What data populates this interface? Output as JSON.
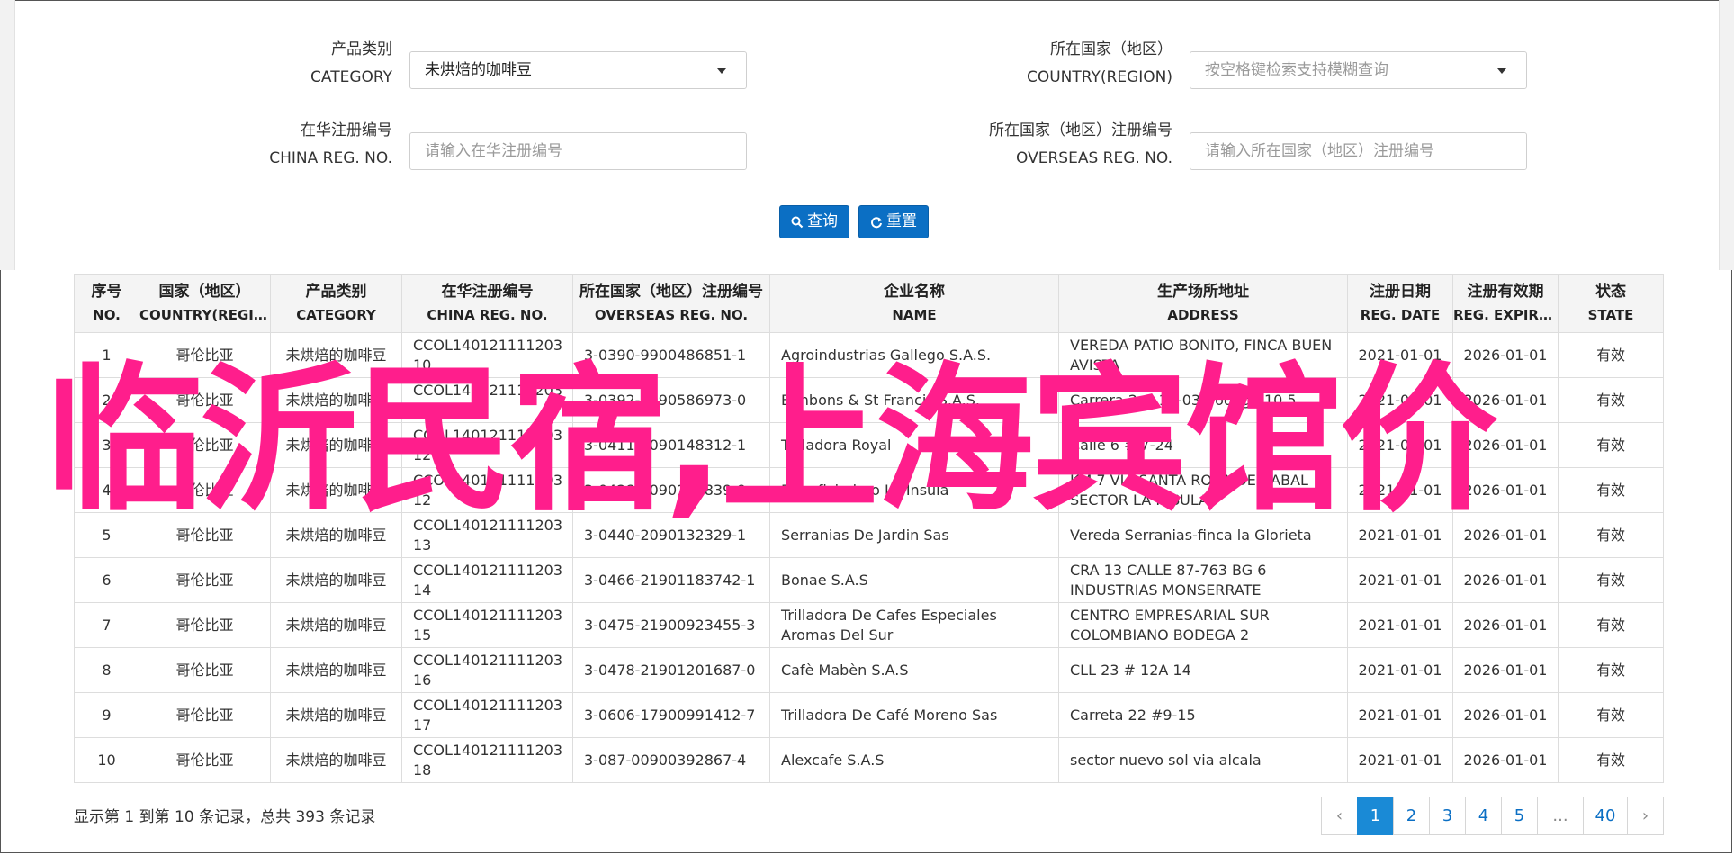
{
  "form": {
    "category": {
      "label_cn": "产品类别",
      "label_en": "CATEGORY",
      "value": "未烘焙的咖啡豆"
    },
    "country": {
      "label_cn": "所在国家（地区）",
      "label_en": "COUNTRY(REGION)",
      "placeholder": "按空格键检索支持模糊查询"
    },
    "china_reg": {
      "label_cn": "在华注册编号",
      "label_en": "CHINA REG. NO.",
      "placeholder": "请输入在华注册编号"
    },
    "overseas_reg": {
      "label_cn": "所在国家（地区）注册编号",
      "label_en": "OVERSEAS REG. NO.",
      "placeholder": "请输入所在国家（地区）注册编号"
    },
    "search_button": "查询",
    "reset_button": "重置"
  },
  "table": {
    "headers": [
      {
        "cn": "序号",
        "en": "NO."
      },
      {
        "cn": "国家（地区）",
        "en": "COUNTRY(REGIO..."
      },
      {
        "cn": "产品类别",
        "en": "CATEGORY"
      },
      {
        "cn": "在华注册编号",
        "en": "CHINA REG. NO."
      },
      {
        "cn": "所在国家（地区）注册编号",
        "en": "OVERSEAS REG. NO."
      },
      {
        "cn": "企业名称",
        "en": "NAME"
      },
      {
        "cn": "生产场所地址",
        "en": "ADDRESS"
      },
      {
        "cn": "注册日期",
        "en": "REG. DATE"
      },
      {
        "cn": "注册有效期",
        "en": "REG. EXPIRE ..."
      },
      {
        "cn": "状态",
        "en": "STATE"
      }
    ],
    "rows": [
      [
        "1",
        "哥伦比亚",
        "未烘焙的咖啡豆",
        "CCOL140121111203 10",
        "3-0390-9900486851-1",
        "Agroindustrias Gallego S.A.S.",
        "VEREDA PATIO BONITO, FINCA BUEN AVISTA",
        "2021-01-01",
        "2026-01-01",
        "有效"
      ],
      [
        "2",
        "哥伦比亚",
        "未烘焙的咖啡豆",
        "CCOL140121111203 11",
        "3-0392-1990586973-0",
        "Bonbons & St Francis S.A.S.",
        "Carrera 2 # 13-03 Bodega 10 5",
        "2021-01-01",
        "2026-01-01",
        "有效"
      ],
      [
        "3",
        "哥伦比亚",
        "未烘焙的咖啡豆",
        "CCOL140121111203 12",
        "3-0411-2090148312-1",
        "Trilladora Royal",
        "Calle 6 # 7-24",
        "2021-01-01",
        "2026-01-01",
        "有效"
      ],
      [
        "4",
        "哥伦比亚",
        "未烘焙的咖啡豆",
        "CCOL140121111203 12",
        "3-0428-2090128839-9",
        "Beneficiadero La Insula",
        "KM 7 VIA SANTA ROSA DE CABAL SECTOR LA INSULA",
        "2021-01-01",
        "2026-01-01",
        "有效"
      ],
      [
        "5",
        "哥伦比亚",
        "未烘焙的咖啡豆",
        "CCOL140121111203 13",
        "3-0440-2090132329-1",
        "Serranias De Jardin Sas",
        "Vereda Serranias-finca la Glorieta",
        "2021-01-01",
        "2026-01-01",
        "有效"
      ],
      [
        "6",
        "哥伦比亚",
        "未烘焙的咖啡豆",
        "CCOL140121111203 14",
        "3-0466-21901183742-1",
        "Bonae S.A.S",
        "CRA 13 CALLE 87-763 BG 6 INDUSTRIAS MONSERRATE",
        "2021-01-01",
        "2026-01-01",
        "有效"
      ],
      [
        "7",
        "哥伦比亚",
        "未烘焙的咖啡豆",
        "CCOL140121111203 15",
        "3-0475-21900923455-3",
        "Trilladora De Cafes Especiales Aromas Del Sur",
        "CENTRO EMPRESARIAL SUR COLOMBIANO BODEGA 2",
        "2021-01-01",
        "2026-01-01",
        "有效"
      ],
      [
        "8",
        "哥伦比亚",
        "未烘焙的咖啡豆",
        "CCOL140121111203 16",
        "3-0478-21901201687-0",
        "Cafè Mabèn S.A.S",
        "CLL 23 # 12A 14",
        "2021-01-01",
        "2026-01-01",
        "有效"
      ],
      [
        "9",
        "哥伦比亚",
        "未烘焙的咖啡豆",
        "CCOL140121111203 17",
        "3-0606-17900991412-7",
        "Trilladora De Café Moreno Sas",
        "Carreta 22 #9-15",
        "2021-01-01",
        "2026-01-01",
        "有效"
      ],
      [
        "10",
        "哥伦比亚",
        "未烘焙的咖啡豆",
        "CCOL140121111203 18",
        "3-087-00900392867-4",
        "Alexcafe S.A.S",
        "sector nuevo sol via alcala",
        "2021-01-01",
        "2026-01-01",
        "有效"
      ]
    ]
  },
  "footer": {
    "summary": "显示第 1 到第 10 条记录，总共 393 条记录",
    "pages": [
      "‹",
      "1",
      "2",
      "3",
      "4",
      "5",
      "...",
      "40",
      "›"
    ],
    "active_page": "1"
  },
  "overlay_text": "临沂民宿,上海宾馆价",
  "colors": {
    "primary": "#0b6fc4",
    "overlay": "#ff1e8c",
    "header_bg": "#f4f4f4"
  }
}
